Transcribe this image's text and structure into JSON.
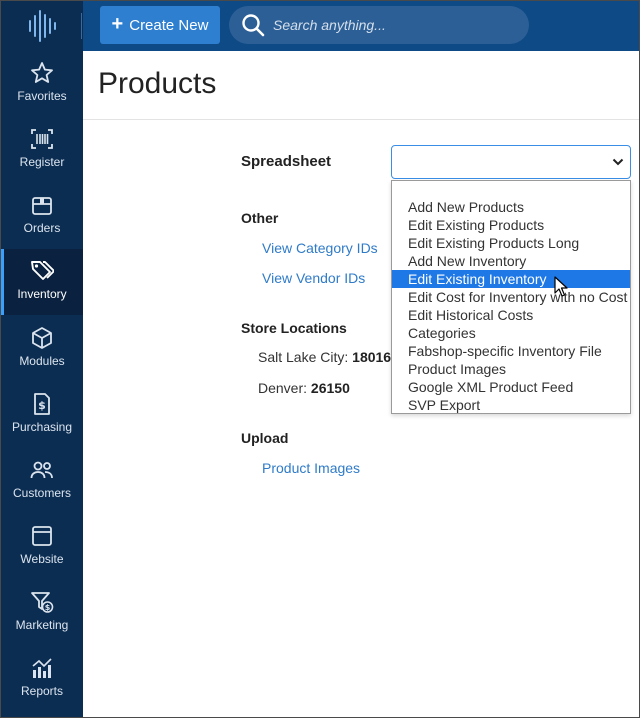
{
  "header": {
    "create_label": "Create New",
    "search_placeholder": "Search anything..."
  },
  "sidebar": {
    "items": [
      {
        "label": "Favorites",
        "icon": "star-icon"
      },
      {
        "label": "Register",
        "icon": "barcode-scanner-icon"
      },
      {
        "label": "Orders",
        "icon": "box-icon"
      },
      {
        "label": "Inventory",
        "icon": "tags-icon",
        "active": true
      },
      {
        "label": "Modules",
        "icon": "cube-icon"
      },
      {
        "label": "Purchasing",
        "icon": "invoice-icon"
      },
      {
        "label": "Customers",
        "icon": "users-icon"
      },
      {
        "label": "Website",
        "icon": "browser-window-icon"
      },
      {
        "label": "Marketing",
        "icon": "funnel-dollar-icon"
      },
      {
        "label": "Reports",
        "icon": "chart-icon"
      }
    ]
  },
  "main": {
    "title": "Products",
    "spreadsheet_label": "Spreadsheet",
    "other_label": "Other",
    "other_links": [
      "View Category IDs",
      "View Vendor IDs"
    ],
    "store_locations_label": "Store Locations",
    "stores": [
      {
        "name": "Salt Lake City:",
        "id": "18016"
      },
      {
        "name": "Denver:",
        "id": "26150"
      }
    ],
    "upload_label": "Upload",
    "upload_links": [
      "Product Images"
    ]
  },
  "dropdown": {
    "selected_value": "",
    "options": [
      "Add New Products",
      "Edit Existing Products",
      "Edit Existing Products Long",
      "Add New Inventory",
      "Edit Existing Inventory",
      "Edit Cost for Inventory with no Cost",
      "Edit Historical Costs",
      "Categories",
      "Fabshop-specific Inventory File",
      "Product Images",
      "Google XML Product Feed",
      "SVP Export"
    ],
    "highlighted": "Edit Existing Inventory"
  },
  "colors": {
    "topbar": "#0e4a86",
    "sidebar": "#0c2d52",
    "accent": "#2f7fd1",
    "link": "#2f7bc8",
    "highlight": "#1e78e6"
  }
}
